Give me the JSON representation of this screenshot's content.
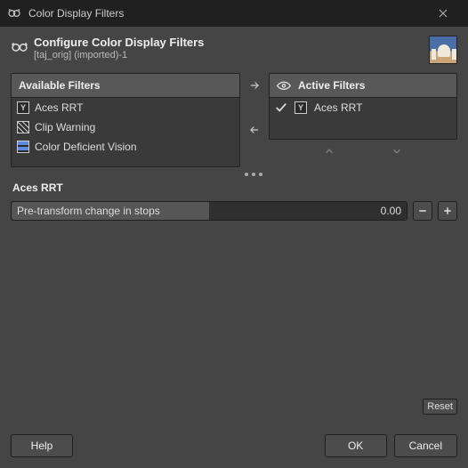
{
  "window": {
    "title": "Color Display Filters"
  },
  "header": {
    "title": "Configure Color Display Filters",
    "subtitle": "[taj_orig] (imported)-1"
  },
  "available": {
    "heading": "Available Filters",
    "items": [
      {
        "label": "Aces RRT"
      },
      {
        "label": "Clip Warning"
      },
      {
        "label": "Color Deficient Vision"
      }
    ]
  },
  "active": {
    "heading": "Active Filters",
    "items": [
      {
        "label": "Aces RRT"
      }
    ]
  },
  "selected_filter": {
    "name": "Aces RRT",
    "param_label": "Pre-transform change in stops",
    "param_value": "0.00"
  },
  "buttons": {
    "reset": "Reset",
    "help": "Help",
    "ok": "OK",
    "cancel": "Cancel"
  }
}
